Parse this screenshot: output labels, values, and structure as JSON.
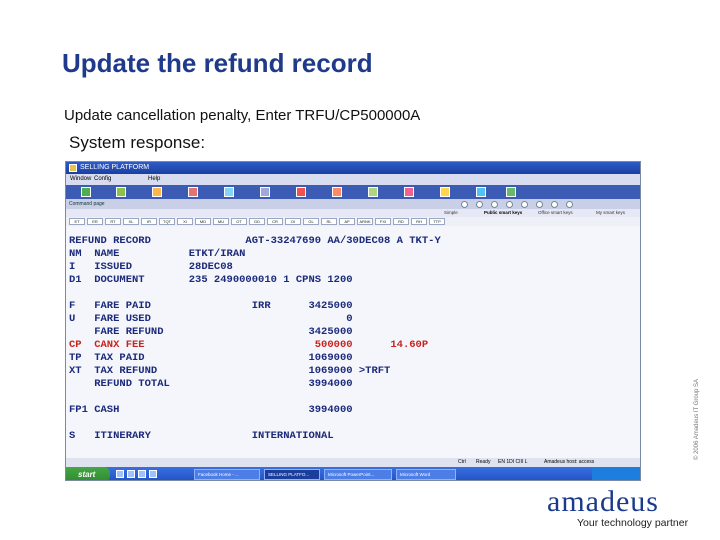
{
  "slide": {
    "title": "Update the refund record",
    "subtitle": "Update cancellation penalty, Enter TRFU/CP500000A",
    "response_label": "System response:",
    "copyright": "© 2006 Amadeus IT Group SA"
  },
  "window": {
    "title": "SELLING PLATFORM",
    "menu": [
      "Window",
      "Config",
      "Help"
    ],
    "command_label": "Command page"
  },
  "view_tabs": [
    "Simple",
    "Public smart keys",
    "Office smart keys",
    "My smart keys"
  ],
  "view_tabs_active": 1,
  "smart_keys": [
    "ET",
    "ER",
    "RT",
    "XL",
    "IR",
    "TQT",
    "XI",
    "MD",
    "MU",
    "OT",
    "GD",
    "CR",
    "OI",
    "GL",
    "RL",
    "AP",
    "ARNK",
    "FXI",
    "RD",
    "RH",
    "TTP"
  ],
  "terminal": {
    "lines": [
      "REFUND RECORD               AGT-33247690 AA/30DEC08 A TKT-Y",
      "NM  NAME           ETKT/IRAN",
      "I   ISSUED         28DEC08",
      "D1  DOCUMENT       235 2490000010 1 CPNS 1200",
      "",
      "F   FARE PAID                IRR      3425000",
      "U   FARE USED                               0",
      "    FARE REFUND                       3425000",
      "CP  CANX FEE                           500000      14.60P",
      "TP  TAX PAID                          1069000",
      "XT  TAX REFUND                        1069000 >TRFT",
      "    REFUND TOTAL                      3994000",
      "",
      "FP1 CASH                              3994000",
      "",
      "S   ITINERARY                INTERNATIONAL"
    ],
    "highlight_line": 8
  },
  "statusbar": {
    "mode": "Ctrl",
    "status": "Ready",
    "session": "EN 1DI CIII L",
    "connection": "Amadeus host: access"
  },
  "taskbar": {
    "start_label": "start",
    "items": [
      "Facebook  Home - ...",
      "SELLING PLATFO...",
      "Microsoft PowerPoint...",
      "Microsoft Word"
    ]
  },
  "logo": {
    "word": "amadeus",
    "tagline": "Your technology partner"
  },
  "colors": {
    "title": "#1f3a8a",
    "terminal_text": "#1b2a7a",
    "terminal_highlight": "#c8241f",
    "logo": "#1a3a8c"
  }
}
